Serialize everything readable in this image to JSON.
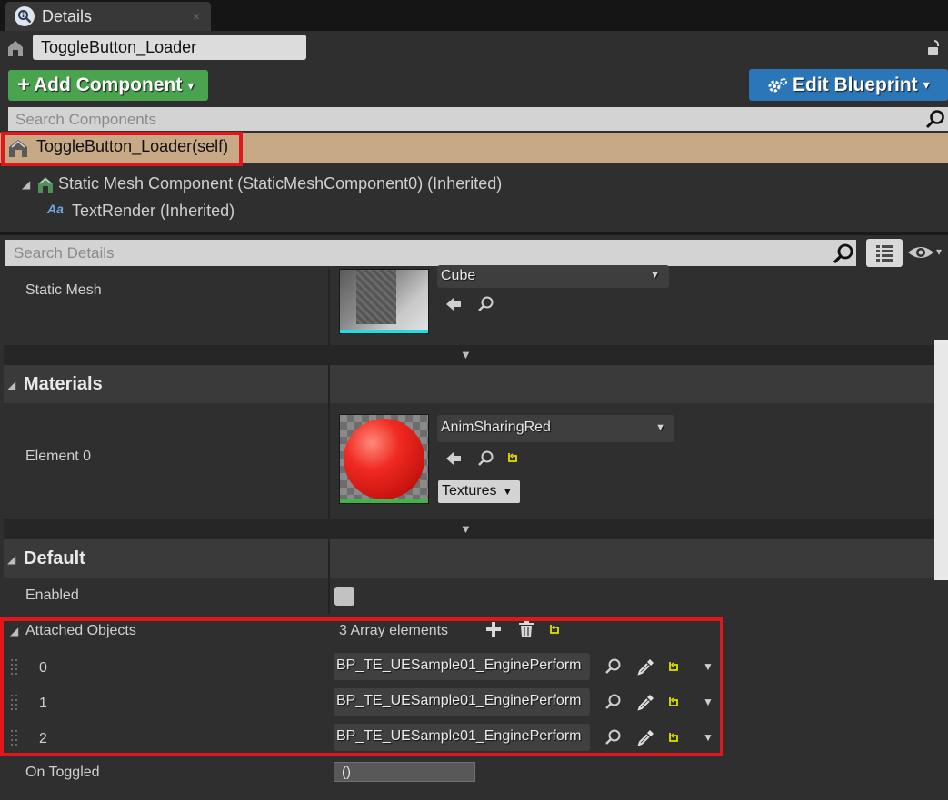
{
  "tab": {
    "title": "Details",
    "close": "×"
  },
  "actor_name": "ToggleButton_Loader",
  "toolbar": {
    "add_component": "Add Component",
    "edit_blueprint": "Edit Blueprint",
    "caret": "▾"
  },
  "components_search": {
    "placeholder": "Search Components"
  },
  "tree": {
    "root": "ToggleButton_Loader(self)",
    "children": [
      {
        "label": "Static Mesh Component (StaticMeshComponent0) (Inherited)"
      },
      {
        "label": "TextRender (Inherited)"
      }
    ]
  },
  "details_search": {
    "placeholder": "Search Details"
  },
  "static_mesh": {
    "label": "Static Mesh",
    "value": "Cube"
  },
  "materials": {
    "category": "Materials",
    "element_label": "Element 0",
    "value": "AnimSharingRed",
    "textures_button": "Textures"
  },
  "default": {
    "category": "Default",
    "enabled_label": "Enabled",
    "attached_label": "Attached Objects",
    "array_count": "3 Array elements",
    "items": [
      {
        "index": "0",
        "value": "BP_TE_UESample01_EnginePerform"
      },
      {
        "index": "1",
        "value": "BP_TE_UESample01_EnginePerform"
      },
      {
        "index": "2",
        "value": "BP_TE_UESample01_EnginePerform"
      }
    ],
    "on_toggled_label": "On Toggled",
    "on_toggled_value": "()"
  },
  "colors": {
    "add_green": "#4aa34e",
    "edit_blue": "#2b76b8",
    "selected_tan": "#c7a986",
    "highlight_red": "#e1171c",
    "reset_yellow": "#e3e000"
  }
}
